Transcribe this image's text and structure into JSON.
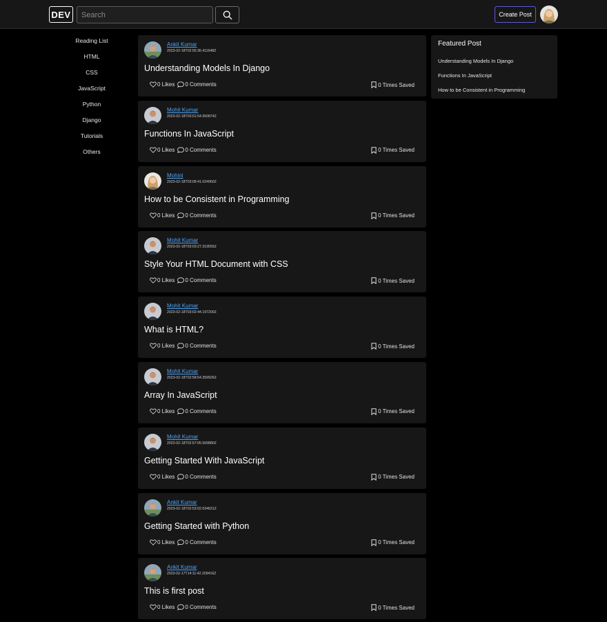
{
  "header": {
    "logo": "DEV",
    "search_placeholder": "Search",
    "create_post_label": "Create Post"
  },
  "sidebar": {
    "items": [
      "Reading List",
      "HTML",
      "CSS",
      "JavaScript",
      "Python",
      "Django",
      "Tutorials",
      "Others"
    ]
  },
  "posts": [
    {
      "author": "Ankit Kumar",
      "date": "2023-02-18T02:55:36.411648Z",
      "title": "Understanding Models In Django",
      "likes": "0 Likes",
      "comments": "0 Comments",
      "saved": "0 Times Saved"
    },
    {
      "author": "Mohit Kumar",
      "date": "2023-02-18T03:01:54.950874Z",
      "title": "Functions In JavaScript",
      "likes": "0 Likes",
      "comments": "0 Comments",
      "saved": "0 Times Saved"
    },
    {
      "author": "Mohini",
      "date": "2023-02-18T03:08:41.024960Z",
      "title": "How to be Consistent in Programming",
      "likes": "0 Likes",
      "comments": "0 Comments",
      "saved": "0 Times Saved"
    },
    {
      "author": "Mohit Kumar",
      "date": "2023-02-18T03:03:27.319556Z",
      "title": "Style Your HTML Document with CSS",
      "likes": "0 Likes",
      "comments": "0 Comments",
      "saved": "0 Times Saved"
    },
    {
      "author": "Mohit Kumar",
      "date": "2023-02-18T03:02:44.197200Z",
      "title": "What is HTML?",
      "likes": "0 Likes",
      "comments": "0 Comments",
      "saved": "0 Times Saved"
    },
    {
      "author": "Mohit Kumar",
      "date": "2023-02-18T02:58:54.359926Z",
      "title": "Array In JavaScript",
      "likes": "0 Likes",
      "comments": "0 Comments",
      "saved": "0 Times Saved"
    },
    {
      "author": "Mohit Kumar",
      "date": "2023-02-18T02:57:05.569880Z",
      "title": "Getting Started With JavaScript",
      "likes": "0 Likes",
      "comments": "0 Comments",
      "saved": "0 Times Saved"
    },
    {
      "author": "Ankit Kumar",
      "date": "2023-02-18T02:53:02.634631Z",
      "title": "Getting Started with Python",
      "likes": "0 Likes",
      "comments": "0 Comments",
      "saved": "0 Times Saved"
    },
    {
      "author": "Ankit Kumar",
      "date": "2023-02-17T14:11:42.209416Z",
      "title": "This is first post",
      "likes": "0 Likes",
      "comments": "0 Comments",
      "saved": "0 Times Saved"
    }
  ],
  "featured": {
    "heading": "Featured Post",
    "items": [
      "Understanding Models In Django",
      "Functions In JavaScript",
      "How to be Consistent in Programming"
    ]
  },
  "icons": {
    "search": "search-icon",
    "like": "heart-icon",
    "comment": "comment-icon",
    "save": "bookmark-icon"
  },
  "colors": {
    "page_background": "#000000",
    "card_background": "#171717",
    "author_link": "#4fa3f7",
    "create_post_border": "#5b5bd6"
  }
}
